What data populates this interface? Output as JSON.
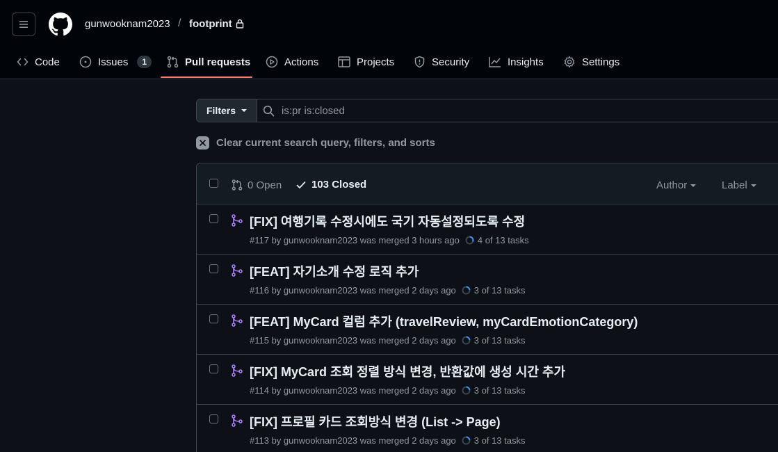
{
  "header": {
    "owner": "gunwooknam2023",
    "separator": "/",
    "repo": "footprint"
  },
  "tabs": [
    {
      "label": "Code"
    },
    {
      "label": "Issues",
      "count": "1"
    },
    {
      "label": "Pull requests"
    },
    {
      "label": "Actions"
    },
    {
      "label": "Projects"
    },
    {
      "label": "Security"
    },
    {
      "label": "Insights"
    },
    {
      "label": "Settings"
    }
  ],
  "search": {
    "filters_label": "Filters",
    "query": "is:pr is:closed"
  },
  "clear_label": "Clear current search query, filters, and sorts",
  "list_header": {
    "open": "0 Open",
    "closed": "103 Closed",
    "author": "Author",
    "label": "Label"
  },
  "prs": [
    {
      "title": "[FIX] 여행기록 수정시에도 국기 자동설정되도록 수정",
      "meta": "#117 by gunwooknam2023 was merged 3 hours ago",
      "tasks": "4 of 13 tasks"
    },
    {
      "title": "[FEAT] 자기소개 수정 로직 추가",
      "meta": "#116 by gunwooknam2023 was merged 2 days ago",
      "tasks": "3 of 13 tasks"
    },
    {
      "title": "[FEAT] MyCard 컬럼 추가 (travelReview, myCardEmotionCategory)",
      "meta": "#115 by gunwooknam2023 was merged 2 days ago",
      "tasks": "3 of 13 tasks"
    },
    {
      "title": "[FIX] MyCard 조회 정렬 방식 변경, 반환값에 생성 시간 추가",
      "meta": "#114 by gunwooknam2023 was merged 2 days ago",
      "tasks": "3 of 13 tasks"
    },
    {
      "title": "[FIX] 프로필 카드 조회방식 변경 (List -> Page)",
      "meta": "#113 by gunwooknam2023 was merged 2 days ago",
      "tasks": "3 of 13 tasks"
    }
  ],
  "colors": {
    "accent_underline": "#f78166",
    "merged": "#ab7df8",
    "progress": "#4493f8"
  }
}
